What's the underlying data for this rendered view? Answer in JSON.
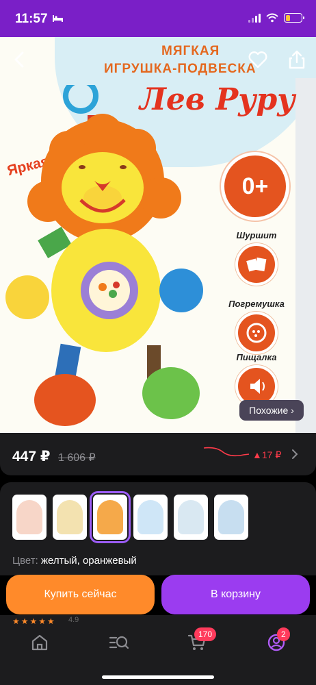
{
  "status": {
    "time": "11:57"
  },
  "product": {
    "promo_title_line1": "МЯГКАЯ",
    "promo_title_line2": "ИГРУШКА-ПОДВЕСКА",
    "promo_title_line3": "Лев Руру",
    "bright_label": "Яркая!",
    "age_badge": "0+",
    "features": [
      {
        "label": "Шуршит",
        "icon": "rustle-icon"
      },
      {
        "label": "Погремушка",
        "icon": "rattle-icon"
      },
      {
        "label": "Пищалка",
        "icon": "squeaker-icon"
      }
    ],
    "similar_label": "Похожие ›"
  },
  "price": {
    "current": "447 ₽",
    "old": "1 606 ₽",
    "change": "▲17 ₽"
  },
  "gallery": {
    "thumbnails": [
      {
        "name": "thumb-1",
        "color": "#f7d6c8",
        "selected": false
      },
      {
        "name": "thumb-2",
        "color": "#f3e2b0",
        "selected": false
      },
      {
        "name": "thumb-3",
        "color": "#f5a94a",
        "selected": true
      },
      {
        "name": "thumb-4",
        "color": "#cfe6f7",
        "selected": false
      },
      {
        "name": "thumb-5",
        "color": "#d9e8f2",
        "selected": false
      },
      {
        "name": "thumb-6",
        "color": "#c7def0",
        "selected": false
      }
    ],
    "color_label": "Цвет:",
    "color_value": "желтый, оранжевый"
  },
  "rating_strip": {
    "stars": "★★★★★",
    "value": "4.9"
  },
  "actions": {
    "buy_now": "Купить сейчас",
    "add_to_cart": "В корзину"
  },
  "tabbar": {
    "cart_badge": "170",
    "profile_badge": "2"
  },
  "colors": {
    "status_bar": "#7a1fc7",
    "buy_now": "#ff8a2a",
    "add_to_cart": "#9b3cf0",
    "badge": "#ff3b5c",
    "price_up": "#ff3b4a"
  }
}
